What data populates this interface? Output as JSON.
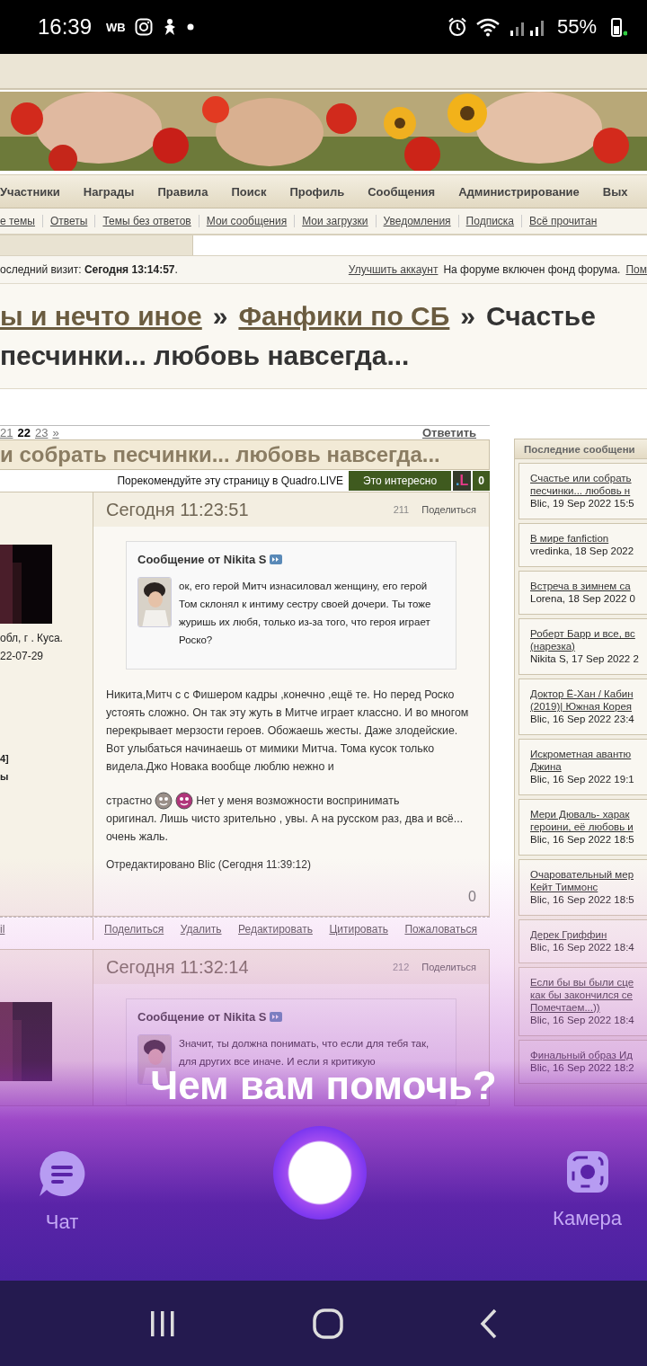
{
  "status_bar": {
    "time": "16:39",
    "carrier": "WB",
    "battery": "55%"
  },
  "nav": [
    "Участники",
    "Награды",
    "Правила",
    "Поиск",
    "Профиль",
    "Сообщения",
    "Администрирование",
    "Вых"
  ],
  "subnav": [
    "е темы",
    "Ответы",
    "Темы без ответов",
    "Мои сообщения",
    "Мои загрузки",
    "Уведомления",
    "Подписка",
    "Всё прочитан"
  ],
  "visit": "оследний визит: **Сегодня 13:14:57**.",
  "upgrade_link": "Улучшить аккаунт",
  "fund_notice": "На форуме включен фонд форума.",
  "help_link": "Пом",
  "breadcrumbs": [
    {
      "label": "ы и нечто иное",
      "kind": "link"
    },
    {
      "label": "»",
      "kind": "separator"
    },
    {
      "label": "Фанфики по СБ",
      "kind": "link"
    },
    {
      "label": "»",
      "kind": "separator"
    },
    {
      "label": "Счастье",
      "kind": "current"
    }
  ],
  "title_line2": "песчинки... любовь навсегда...",
  "pager": [
    {
      "label": "21",
      "selected": false
    },
    {
      "label": "22",
      "selected": true
    },
    {
      "label": "23",
      "selected": false
    },
    {
      "label": "»",
      "selected": false
    }
  ],
  "reply": "Ответить",
  "topic_title": "и собрать песчинки... любовь навсегда...",
  "recommend": {
    "text": "Порекомендуйте эту страницу в Quadro.LIVE",
    "button": "Это интересно",
    "logo": ".L",
    "count": "0"
  },
  "posts": [
    {
      "time": "Сегодня 11:23:51",
      "number": "211",
      "share": "Поделиться",
      "user_lines": [
        "обл, г . Куса.",
        "22-07-29"
      ],
      "user_extra": [
        "4]",
        "ы"
      ],
      "quote": {
        "author": "Сообщение от Nikita S",
        "text": "ок, его герой Митч изнасиловал женщину, его герой Том склонял к интиму сестру своей дочери. Ты тоже журишь их любя, только из-за того, что героя играет Роско?"
      },
      "body": [
        "Никита,Митч с с Фишером кадры ,конечно ,ещё те. Но перед Роско устоять сложно. Он так эту жуть в Митче играет классно. И во многом перекрывает мерзости героев. Обожаешь жесты. Даже злодейские.  Вот улыбаться начинаешь от мимики Митча. Тома кусок только видела.Джо Новака вообще люблю нежно и",
        "страстно",
        "Нет у меня возможности воспринимать",
        "оригинал. Лишь чисто зрительно , увы. А на русском раз, два и всё... очень жаль."
      ],
      "edited": "Отредактировано Blic (Сегодня 11:39:12)",
      "likes": "0",
      "user_link": "il",
      "actions": [
        "Поделиться",
        "Удалить",
        "Редактировать",
        "Цитировать",
        "Пожаловаться"
      ]
    },
    {
      "time": "Сегодня 11:32:14",
      "number": "212",
      "share": "Поделиться",
      "quote": {
        "author": "Сообщение от Nikita S",
        "text": "Значит, ты должна понимать, что если для тебя так, для других все иначе. И если я критикую"
      }
    }
  ],
  "sidebar": {
    "title": "Последние сообщени",
    "items": [
      {
        "lines": [
          "Счастье или собрать",
          "песчинки... любовь н"
        ],
        "meta": "Blic, 19 Sep 2022 15:5"
      },
      {
        "lines": [
          "В мире fanfiction"
        ],
        "meta": "vredinka, 18 Sep 2022"
      },
      {
        "lines": [
          "Встреча в зимнем са"
        ],
        "meta": "Lorena, 18 Sep 2022 0"
      },
      {
        "lines": [
          "Роберт Барр и все, вс",
          "(нарезка)"
        ],
        "meta": "Nikita S, 17 Sep 2022 2"
      },
      {
        "lines": [
          "Доктор Ё-Хан / Кабин",
          "(2019)| Южная Корея"
        ],
        "meta": "Blic, 16 Sep 2022 23:4"
      },
      {
        "lines": [
          "Искрометная авантю",
          "Джина"
        ],
        "meta": "Blic, 16 Sep 2022 19:1"
      },
      {
        "lines": [
          "Мери Дюваль- харак",
          "героини, её любовь и"
        ],
        "meta": "Blic, 16 Sep 2022 18:5"
      },
      {
        "lines": [
          "Очаровательный мер",
          "Кейт Тиммонс"
        ],
        "meta": "Blic, 16 Sep 2022 18:5"
      },
      {
        "lines": [
          "Дерек Гриффин"
        ],
        "meta": "Blic, 16 Sep 2022 18:4"
      },
      {
        "lines": [
          "Если бы вы были сце",
          "как бы закончился се",
          "Помечтаем...))"
        ],
        "meta": "Blic, 16 Sep 2022 18:4"
      },
      {
        "lines": [
          "Финальный образ Ид"
        ],
        "meta": "Blic, 16 Sep 2022 18:2"
      }
    ]
  },
  "assistant": {
    "prompt": "Чем вам помочь?",
    "chat": "Чат",
    "camera": "Камера"
  }
}
